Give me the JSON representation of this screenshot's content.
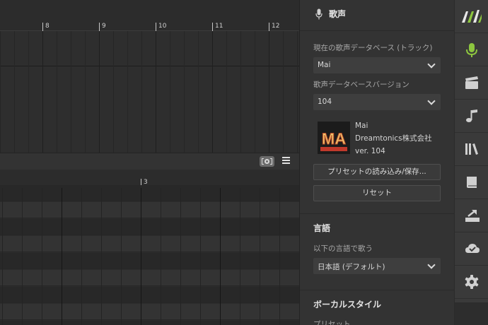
{
  "timeline_top": {
    "markers": [
      "8",
      "9",
      "10",
      "11",
      "12"
    ]
  },
  "timeline_bottom": {
    "markers": [
      "3"
    ]
  },
  "panel": {
    "title": "歌声",
    "voicebank_label": "現在の歌声データベース (トラック)",
    "voicebank_value": "Mai",
    "version_label": "歌声データベースバージョン",
    "version_value": "104",
    "voice_name": "Mai",
    "voice_company": "Dreamtonics株式会社",
    "voice_version": "ver. 104",
    "avatar_text": "MA",
    "load_preset_button": "プリセットの読み込み/保存...",
    "reset_button": "リセット",
    "language_section": "言語",
    "language_label": "以下の言語で歌う",
    "language_value": "日本語 (デフォルト)",
    "vocal_style_section": "ボーカルスタイル",
    "preset_label": "プリセット"
  },
  "sidebar": {
    "items": [
      {
        "name": "app-logo",
        "icon": "logo-icon"
      },
      {
        "name": "voice",
        "icon": "microphone-icon",
        "active": true
      },
      {
        "name": "render",
        "icon": "clapperboard-icon"
      },
      {
        "name": "note",
        "icon": "music-note-icon"
      },
      {
        "name": "library",
        "icon": "library-icon"
      },
      {
        "name": "lyrics",
        "icon": "book-icon"
      },
      {
        "name": "export",
        "icon": "export-icon"
      },
      {
        "name": "cloud",
        "icon": "cloud-check-icon"
      },
      {
        "name": "settings",
        "icon": "gear-icon"
      }
    ]
  },
  "colors": {
    "accent": "#8dc63f",
    "background": "#2c2c2c",
    "panel": "#333333",
    "sidebar": "#3a3a3a"
  }
}
